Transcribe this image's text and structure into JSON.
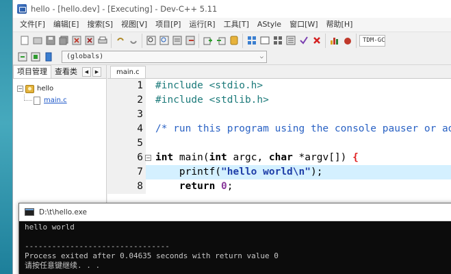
{
  "window": {
    "title": "hello - [hello.dev] - [Executing] - Dev-C++ 5.11"
  },
  "menu": [
    "文件[F]",
    "编辑[E]",
    "搜索[S]",
    "视图[V]",
    "项目[P]",
    "运行[R]",
    "工具[T]",
    "AStyle",
    "窗口[W]",
    "帮助[H]"
  ],
  "toolbar": {
    "compiler_combo": "TDM-GCC"
  },
  "toolbar2": {
    "scope_combo": "(globals)"
  },
  "left_pane": {
    "tabs": [
      "项目管理",
      "查看类"
    ],
    "tree": {
      "project": "hello",
      "file": "main.c"
    }
  },
  "editor": {
    "tab": "main.c",
    "lines": [
      {
        "num": "1",
        "tokens": [
          {
            "t": "pp",
            "v": "#include <stdio.h>"
          }
        ]
      },
      {
        "num": "2",
        "tokens": [
          {
            "t": "pp",
            "v": "#include <stdlib.h>"
          }
        ]
      },
      {
        "num": "3",
        "tokens": []
      },
      {
        "num": "4",
        "tokens": [
          {
            "t": "cm",
            "v": "/* run this program using the console pauser or add your own getch, system(\"pause\") or input loop */"
          }
        ]
      },
      {
        "num": "5",
        "tokens": []
      },
      {
        "num": "6",
        "fold": "−",
        "tokens": [
          {
            "t": "kw",
            "v": "int"
          },
          {
            "t": "plain",
            "v": " main("
          },
          {
            "t": "kw",
            "v": "int"
          },
          {
            "t": "plain",
            "v": " argc, "
          },
          {
            "t": "kw",
            "v": "char"
          },
          {
            "t": "plain",
            "v": " *argv[]) "
          },
          {
            "t": "pun",
            "v": "{"
          }
        ]
      },
      {
        "num": "7",
        "hl": true,
        "tokens": [
          {
            "t": "plain",
            "v": "    printf("
          },
          {
            "t": "str",
            "v": "\"hello world\\n\""
          },
          {
            "t": "plain",
            "v": ");"
          }
        ]
      },
      {
        "num": "8",
        "tokens": [
          {
            "t": "plain",
            "v": "    "
          },
          {
            "t": "kw",
            "v": "return"
          },
          {
            "t": "plain",
            "v": " "
          },
          {
            "t": "num",
            "v": "0"
          },
          {
            "t": "plain",
            "v": ";"
          }
        ]
      }
    ]
  },
  "console": {
    "title": "D:\\t\\hello.exe",
    "lines": [
      "hello world",
      "",
      "--------------------------------",
      "Process exited after 0.04635 seconds with return value 0",
      "请按任意键继续. . ."
    ]
  },
  "colors": {
    "line_highlight": "#d4f0ff",
    "preprocessor": "#1c7a7a",
    "comment": "#2a62c4",
    "string": "#1f3ea8",
    "number": "#8a3b9b",
    "brace": "#e02020",
    "console_bg": "#0c0c0c"
  }
}
